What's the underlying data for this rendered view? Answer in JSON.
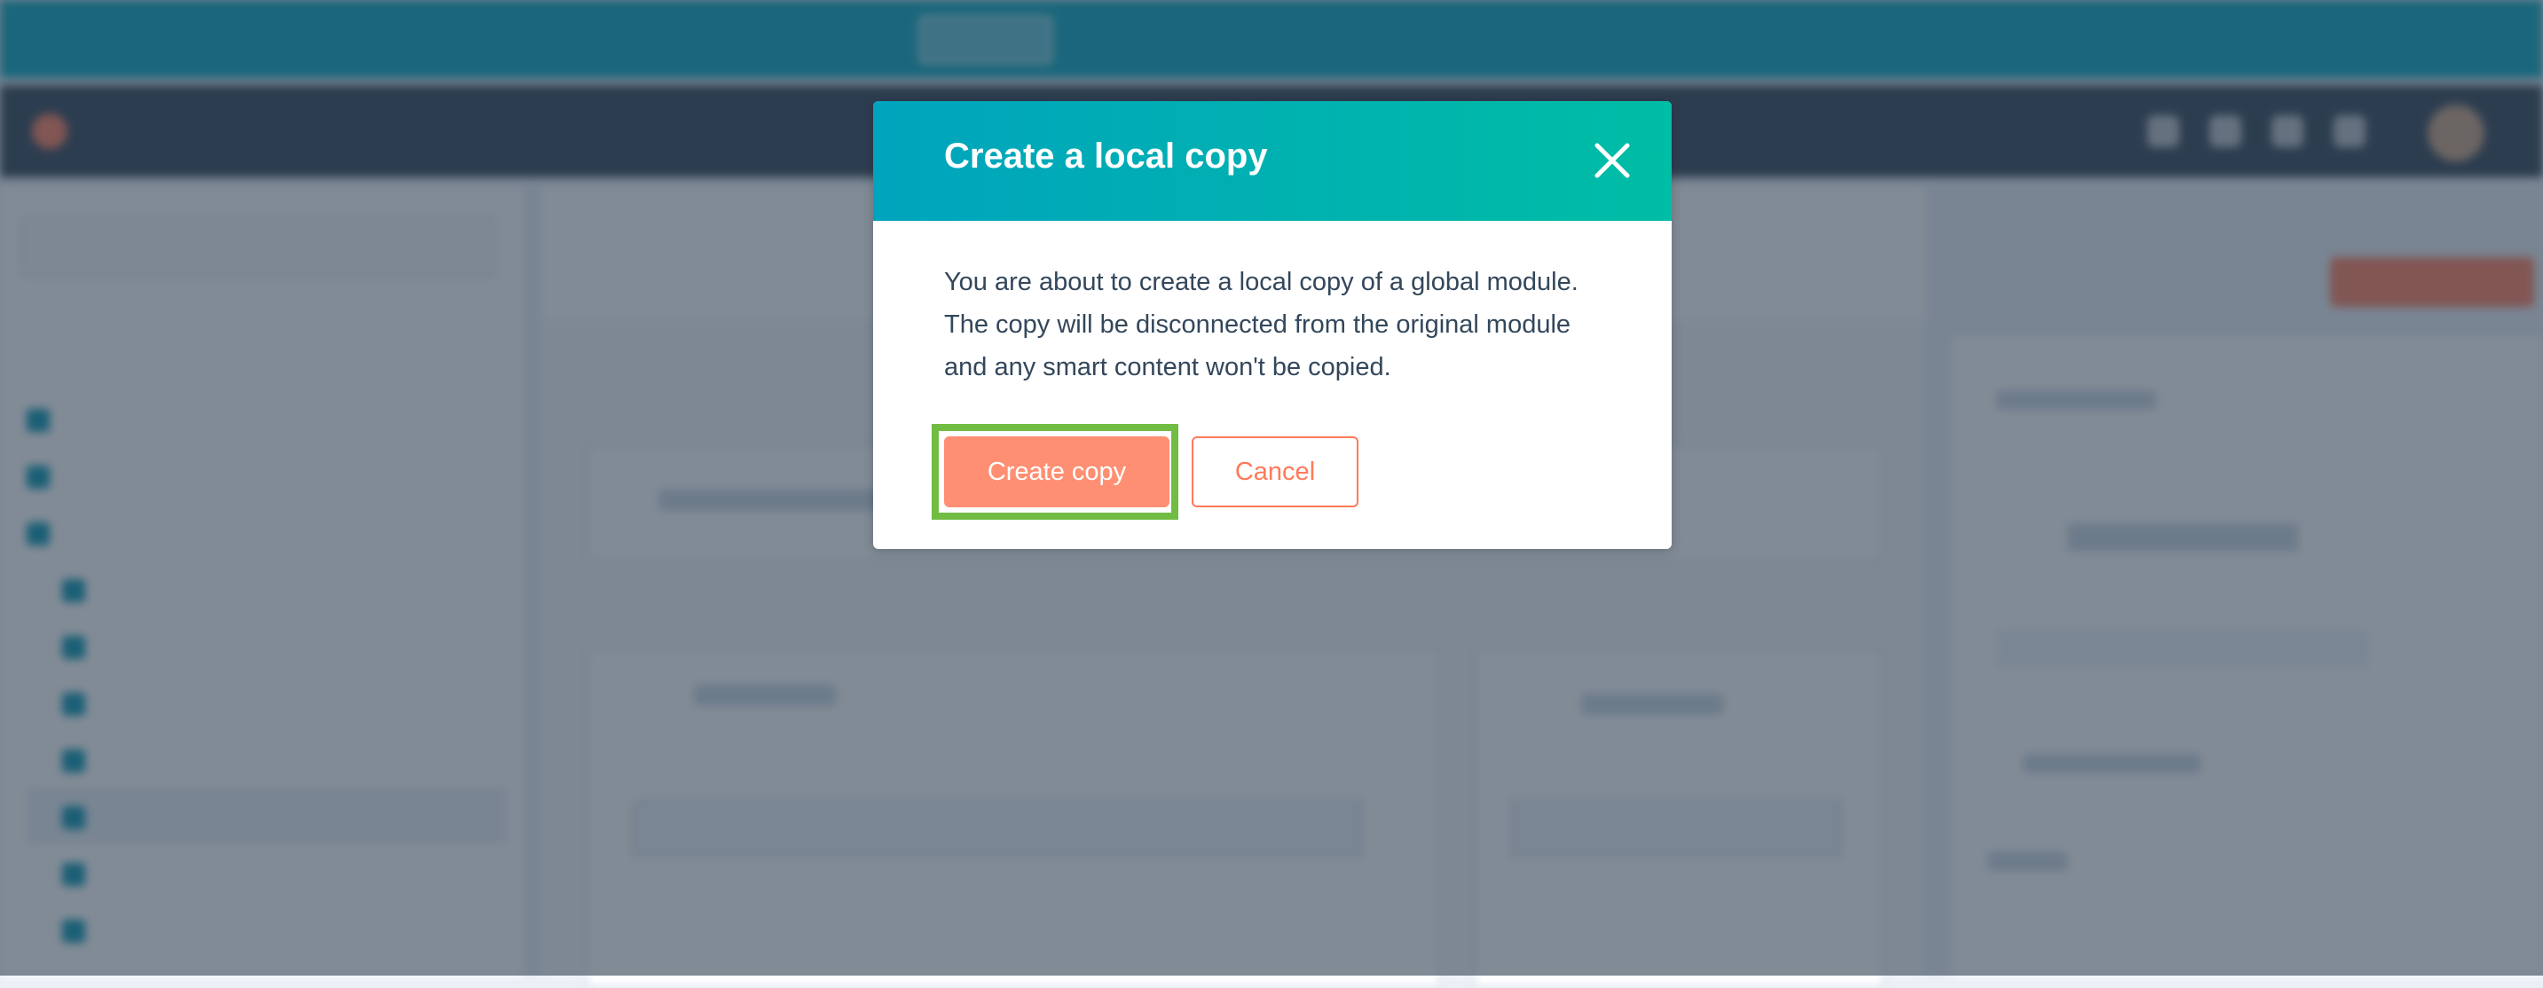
{
  "modal": {
    "title": "Create a local copy",
    "body_lines": [
      "You are about to create a local copy of a global module.",
      "The copy will be disconnected from the original module",
      "and any smart content won't be copied."
    ],
    "create_button": "Create copy",
    "cancel_button": "Cancel",
    "close_icon": "close-icon"
  },
  "colors": {
    "header_gradient_start": "#00a4bd",
    "header_gradient_end": "#00bda5",
    "primary_button": "#ff8f73",
    "accent": "#ff7a59",
    "highlight_outline": "#71bc43",
    "overlay": "#2d3e50"
  }
}
